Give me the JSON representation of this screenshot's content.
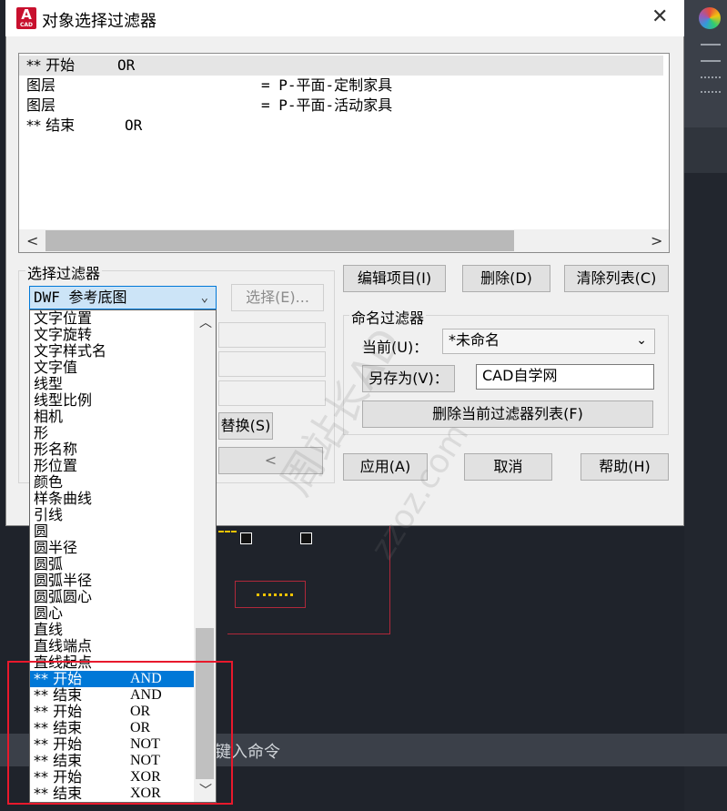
{
  "window": {
    "title": "对象选择过滤器",
    "app_icon_letter": "A",
    "app_icon_sub": "CAD"
  },
  "filter_list": [
    {
      "name": "** 开始",
      "value": "OR"
    },
    {
      "name": "图层",
      "value": "= P-平面-定制家具"
    },
    {
      "name": "图层",
      "value": "= P-平面-活动家具"
    },
    {
      "name": "** 结束",
      "value": "OR"
    }
  ],
  "select_filter": {
    "group_label": "选择过滤器",
    "current": "DWF 参考底图",
    "select_button": "选择(E)...",
    "replace_button": "替换(S)",
    "add_button": "<"
  },
  "dropdown_items": [
    "文字位置",
    "文字旋转",
    "文字样式名",
    "文字值",
    "线型",
    "线型比例",
    "相机",
    "形",
    "形名称",
    "形位置",
    "颜色",
    "样条曲线",
    "引线",
    "圆",
    "圆半径",
    "圆弧",
    "圆弧半径",
    "圆弧圆心",
    "圆心",
    "直线",
    "直线端点",
    "直线起点"
  ],
  "operator_items": [
    {
      "name": "** 开始",
      "op": "AND"
    },
    {
      "name": "** 结束",
      "op": "AND"
    },
    {
      "name": "** 开始",
      "op": "OR"
    },
    {
      "name": "** 结束",
      "op": "OR"
    },
    {
      "name": "** 开始",
      "op": "NOT"
    },
    {
      "name": "** 结束",
      "op": "NOT"
    },
    {
      "name": "** 开始",
      "op": "XOR"
    },
    {
      "name": "** 结束",
      "op": "XOR"
    }
  ],
  "buttons": {
    "edit_item": "编辑项目(I)",
    "delete": "删除(D)",
    "clear_list": "清除列表(C)",
    "apply": "应用(A)",
    "cancel": "取消",
    "help": "帮助(H)"
  },
  "named_filter": {
    "group_label": "命名过滤器",
    "current_label": "当前(U)：",
    "current_value": "*未命名",
    "save_as_button": "另存为(V)：",
    "save_as_value": "CAD自学网",
    "delete_current_button": "删除当前过滤器列表(F)"
  },
  "command_bar": {
    "placeholder": "键入命令"
  },
  "watermarks": [
    "周站长AD",
    "zzoz.com"
  ],
  "colors": {
    "selection": "#0078d7",
    "highlight_border": "#e8192c",
    "combo_bg": "#cce4f7"
  }
}
